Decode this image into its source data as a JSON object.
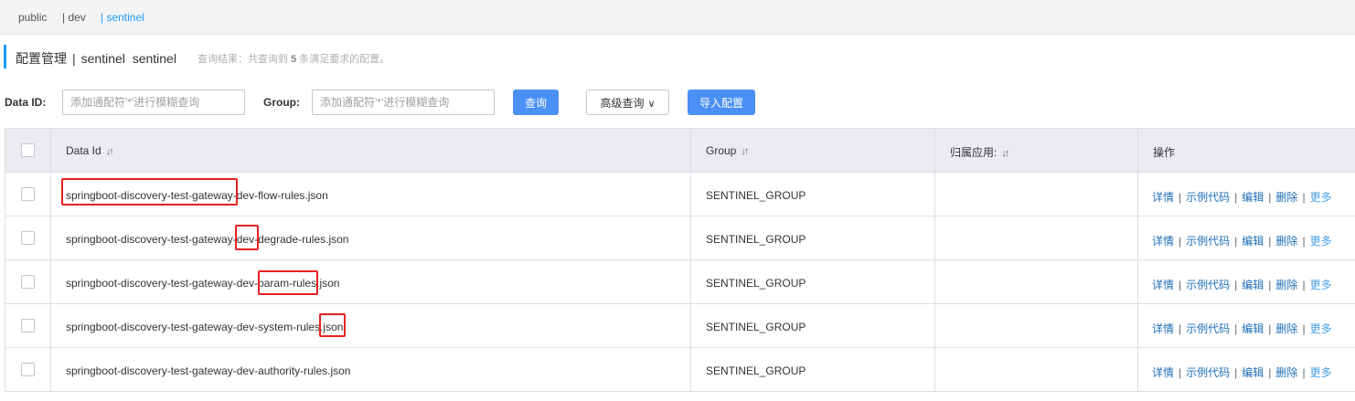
{
  "namespaces": {
    "items": [
      {
        "label": "public"
      },
      {
        "label": "| dev"
      },
      {
        "label": "| sentinel"
      }
    ],
    "active_index": 2
  },
  "header": {
    "title": "配置管理",
    "separator": "|",
    "namespace_name": "sentinel",
    "namespace_id": "sentinel",
    "result_prefix": "查询结果：共查询到",
    "result_count": "5",
    "result_suffix": "条满足要求的配置。"
  },
  "search": {
    "data_id_label": "Data ID:",
    "data_id_placeholder": "添加通配符'*'进行模糊查询",
    "group_label": "Group:",
    "group_placeholder": "添加通配符'*'进行模糊查询",
    "query_button": "查询",
    "advanced_button": "高级查询",
    "import_button": "导入配置"
  },
  "table": {
    "columns": [
      {
        "label": "Data Id",
        "sortable": true
      },
      {
        "label": "Group",
        "sortable": true
      },
      {
        "label": "归属应用:",
        "sortable": true
      },
      {
        "label": "操作",
        "sortable": false
      }
    ],
    "rows": [
      {
        "data_id": "springboot-discovery-test-gateway-dev-flow-rules.json",
        "group": "SENTINEL_GROUP",
        "app": ""
      },
      {
        "data_id": "springboot-discovery-test-gateway-dev-degrade-rules.json",
        "group": "SENTINEL_GROUP",
        "app": ""
      },
      {
        "data_id": "springboot-discovery-test-gateway-dev-param-rules.json",
        "group": "SENTINEL_GROUP",
        "app": ""
      },
      {
        "data_id": "springboot-discovery-test-gateway-dev-system-rules.json",
        "group": "SENTINEL_GROUP",
        "app": ""
      },
      {
        "data_id": "springboot-discovery-test-gateway-dev-authority-rules.json",
        "group": "SENTINEL_GROUP",
        "app": ""
      }
    ],
    "actions": {
      "detail": "详情",
      "sample_code": "示例代码",
      "edit": "编辑",
      "delete": "删除",
      "more": "更多",
      "separator": "|"
    }
  },
  "colors": {
    "accent": "#209bfa",
    "primary_button": "#4a90f5",
    "link": "#1f6fb8",
    "highlight_box": "#e52121"
  },
  "icons": {
    "sort": "sort-icon",
    "advanced_chevron": "chevron-down-icon"
  }
}
